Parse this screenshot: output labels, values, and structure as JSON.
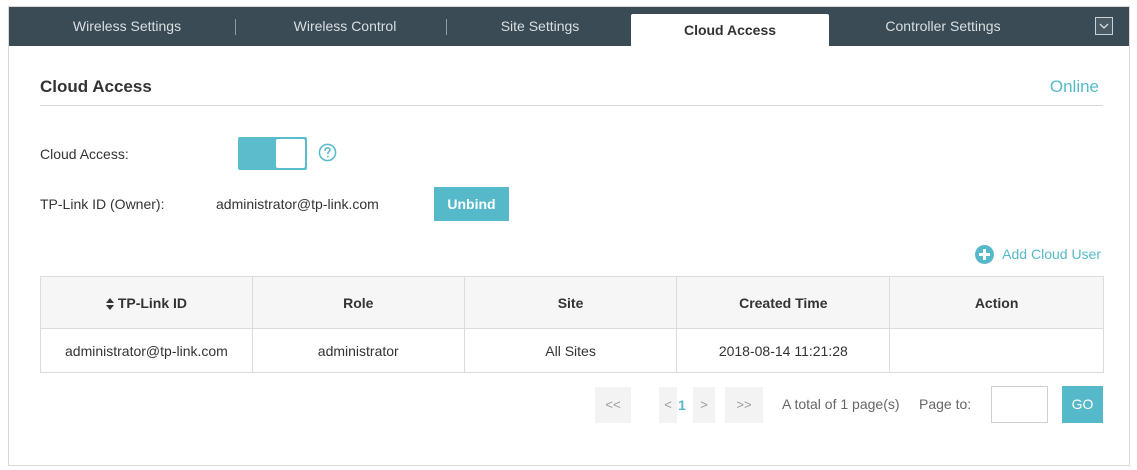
{
  "tabs": [
    {
      "label": "Wireless Settings",
      "active": false
    },
    {
      "label": "Wireless Control",
      "active": false
    },
    {
      "label": "Site Settings",
      "active": false
    },
    {
      "label": "Cloud Access",
      "active": true
    },
    {
      "label": "Controller Settings",
      "active": false
    }
  ],
  "section": {
    "title": "Cloud Access",
    "status": "Online"
  },
  "form": {
    "cloud_access_label": "Cloud Access:",
    "cloud_access_enabled": true,
    "owner_label": "TP-Link ID (Owner):",
    "owner_value": "administrator@tp-link.com",
    "unbind_label": "Unbind"
  },
  "add_cloud_user_label": "Add Cloud User",
  "table": {
    "columns": [
      "TP-Link ID",
      "Role",
      "Site",
      "Created Time",
      "Action"
    ],
    "rows": [
      [
        "administrator@tp-link.com",
        "administrator",
        "All Sites",
        "2018-08-14 11:21:28",
        ""
      ]
    ]
  },
  "pagination": {
    "first": "<<",
    "prev": "<",
    "current": "1",
    "next": ">",
    "last": ">>",
    "total_text": "A total of 1 page(s)",
    "page_to_label": "Page to:",
    "page_input_value": "",
    "go_label": "GO"
  },
  "colors": {
    "accent": "#56b9c9",
    "tab_bar": "#3a4b55"
  }
}
